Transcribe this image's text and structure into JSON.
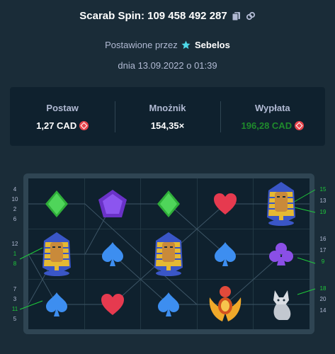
{
  "header": {
    "title": "Scarab Spin: 109 458 492 287",
    "placed_by_prefix": "Postawione przez",
    "username": "Sebelos",
    "date": "dnia 13.09.2022 o 01:39"
  },
  "stats": {
    "bet_label": "Postaw",
    "bet_value": "1,27 CAD",
    "multiplier_label": "Mnożnik",
    "multiplier_value": "154,35×",
    "payout_label": "Wypłata",
    "payout_value": "196,28 CAD"
  },
  "colors": {
    "background": "#1a2c38",
    "panel": "#0f212e",
    "win_green": "#1fcb3a",
    "payout_green": "#1f8a2c",
    "coin_red": "#e8454c"
  },
  "reels": [
    [
      "green-diamond",
      "pharaoh",
      "blue-spade"
    ],
    [
      "purple-pentagon",
      "blue-spade",
      "red-heart"
    ],
    [
      "green-diamond",
      "pharaoh",
      "blue-spade"
    ],
    [
      "red-heart",
      "blue-spade",
      "golden-scarab"
    ],
    [
      "pharaoh",
      "purple-club",
      "grey-cat"
    ]
  ],
  "paylines": {
    "left": [
      {
        "label": "4",
        "win": false
      },
      {
        "label": "10",
        "win": false
      },
      {
        "label": "2",
        "win": false
      },
      {
        "label": "6",
        "win": false
      },
      {
        "label": "12",
        "win": false
      },
      {
        "label": "1",
        "win": true
      },
      {
        "label": "8",
        "win": true
      },
      {
        "label": "7",
        "win": false
      },
      {
        "label": "3",
        "win": false
      },
      {
        "label": "11",
        "win": true
      },
      {
        "label": "5",
        "win": false
      }
    ],
    "right": [
      {
        "label": "15",
        "win": true
      },
      {
        "label": "13",
        "win": false
      },
      {
        "label": "19",
        "win": true
      },
      {
        "label": "16",
        "win": false
      },
      {
        "label": "17",
        "win": false
      },
      {
        "label": "9",
        "win": true
      },
      {
        "label": "18",
        "win": true
      },
      {
        "label": "20",
        "win": false
      },
      {
        "label": "14",
        "win": false
      }
    ]
  }
}
